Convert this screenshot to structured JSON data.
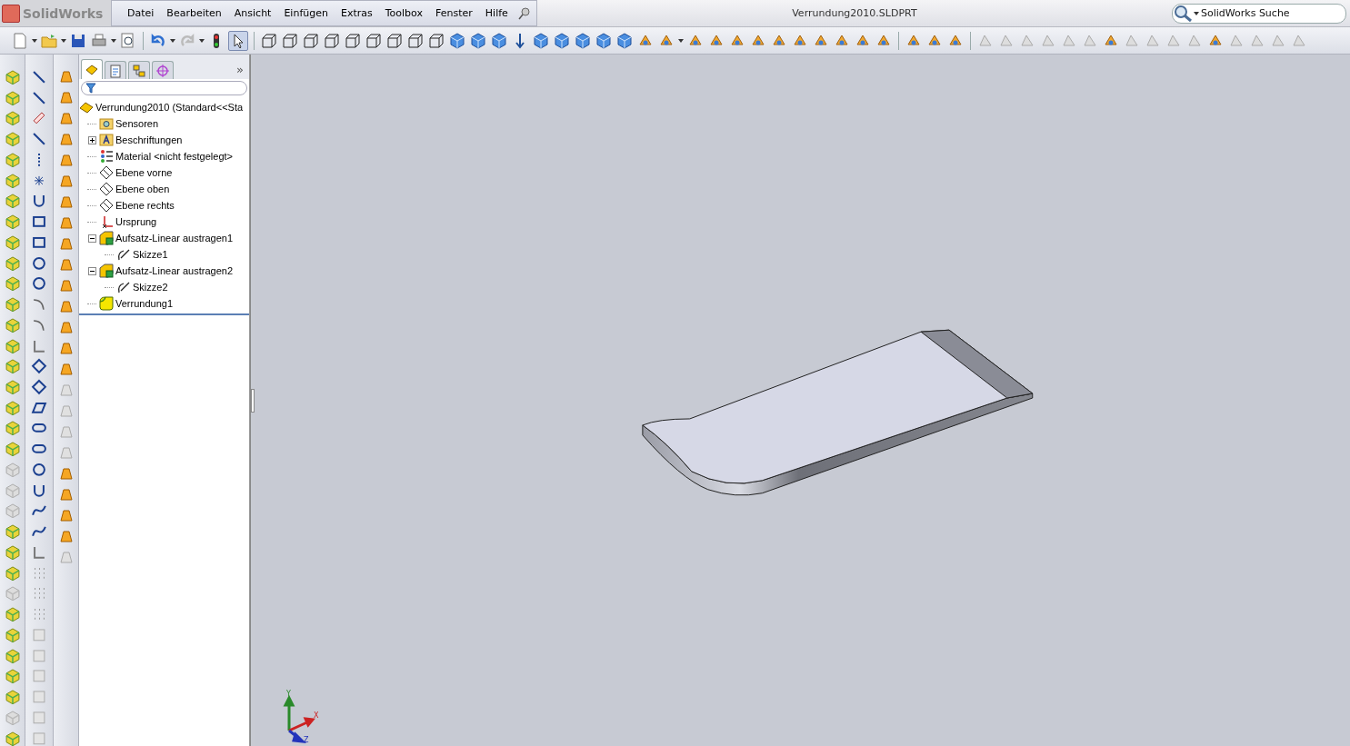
{
  "app": {
    "logo": "SolidWorks"
  },
  "menu": [
    "Datei",
    "Bearbeiten",
    "Ansicht",
    "Einfügen",
    "Extras",
    "Toolbox",
    "Fenster",
    "Hilfe"
  ],
  "window": {
    "title": "Verrundung2010.SLDPRT"
  },
  "search": {
    "placeholder": "SolidWorks Suche"
  },
  "panel_tabs": [
    {
      "kind": "features",
      "selected": true
    },
    {
      "kind": "properties",
      "selected": false
    },
    {
      "kind": "configurations",
      "selected": false
    },
    {
      "kind": "target",
      "selected": false
    }
  ],
  "panel_more": "»",
  "tree": {
    "label": "Verrundung2010  (Standard<<Sta",
    "kind": "part",
    "children": [
      {
        "label": "Sensoren",
        "kind": "sensor"
      },
      {
        "label": "Beschriftungen",
        "kind": "annotations",
        "expanded": false
      },
      {
        "label": "Material <nicht festgelegt>",
        "kind": "material"
      },
      {
        "label": "Ebene vorne",
        "kind": "plane"
      },
      {
        "label": "Ebene oben",
        "kind": "plane"
      },
      {
        "label": "Ebene rechts",
        "kind": "plane"
      },
      {
        "label": "Ursprung",
        "kind": "origin"
      },
      {
        "label": "Aufsatz-Linear austragen1",
        "kind": "extrude",
        "expanded": true,
        "children": [
          {
            "label": "Skizze1",
            "kind": "sketch"
          }
        ]
      },
      {
        "label": "Aufsatz-Linear austragen2",
        "kind": "extrude",
        "expanded": true,
        "children": [
          {
            "label": "Skizze2",
            "kind": "sketch"
          }
        ]
      },
      {
        "label": "Verrundung1",
        "kind": "fillet"
      }
    ]
  },
  "triad": {
    "x": "X",
    "y": "Y",
    "z": "Z"
  }
}
